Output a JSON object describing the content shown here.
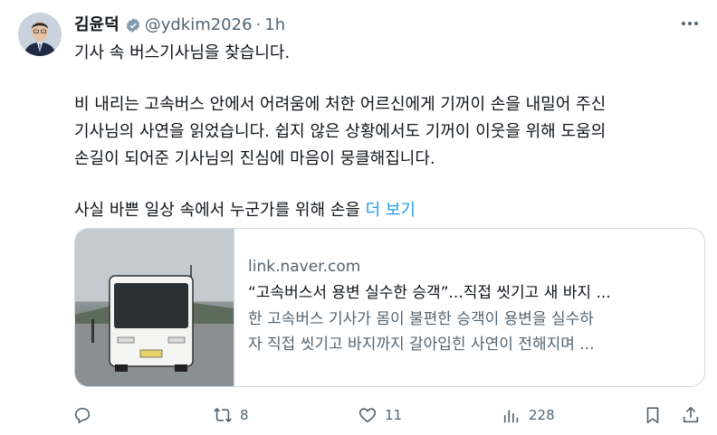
{
  "post": {
    "author_name": "김윤덕",
    "handle": "@ydkim2026",
    "separator": "·",
    "timestamp": "1h",
    "text_lines": [
      "기사 속 버스기사님을 찾습니다.",
      "비 내리는 고속버스 안에서 어려움에 처한 어르신에게 기꺼이 손을 내밀어 주신",
      "기사님의 사연을 읽었습니다. 쉽지 않은 상황에서도 기꺼이 이웃을 위해 도움의",
      "손길이 되어준 기사님의 진심에 마음이 뭉클해집니다.",
      "사실 바쁜 일상 속에서 누군가를 위해 손을"
    ],
    "show_more": "더 보기"
  },
  "card": {
    "domain": "link.naver.com",
    "title": "“고속버스서 용변 실수한 승객”...직접 씻기고 새 바지 ...",
    "desc_lines": [
      "한 고속버스 기사가 몸이 불편한 승객이 용변을 실수하",
      "자 직접 씻기고 바지까지 갈아입힌 사연이 전해지며 ..."
    ]
  },
  "actions": {
    "reposts": "8",
    "likes": "11",
    "views": "228"
  },
  "colors": {
    "text": "#0f1419",
    "secondary": "#536471",
    "accent": "#1d9bf0",
    "border": "#cfd9de"
  }
}
